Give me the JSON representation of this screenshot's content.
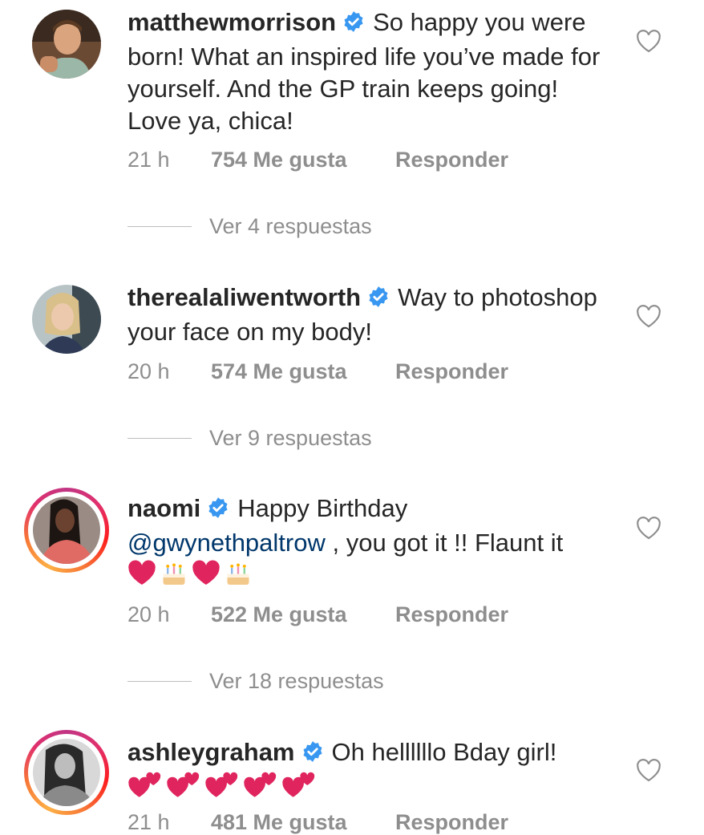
{
  "comments": [
    {
      "username": "matthewmorrison",
      "text": "So happy you were born!  What an inspired life you’ve made for yourself. And the GP train keeps going! Love ya, chica!",
      "time": "21 h",
      "likes": "754 Me gusta",
      "reply": "Responder",
      "replies": "Ver 4 respuestas"
    },
    {
      "username": "therealaliwentworth",
      "text": "Way to photoshop your face on my body!",
      "time": "20 h",
      "likes": "574 Me gusta",
      "reply": "Responder",
      "replies": "Ver 9 respuestas"
    },
    {
      "username": "naomi",
      "text_before": "Happy Birthday",
      "mention": "@gwynethpaltrow",
      "text_after": " , you got it !! Flaunt it",
      "emojis": [
        "red-heart",
        "birthday-cake",
        "red-heart",
        "birthday-cake"
      ],
      "time": "20 h",
      "likes": "522 Me gusta",
      "reply": "Responder",
      "replies": "Ver 18 respuestas"
    },
    {
      "username": "ashleygraham",
      "text": "Oh hellllllo Bday girl!",
      "emojis": [
        "two-hearts",
        "two-hearts",
        "two-hearts",
        "two-hearts",
        "two-hearts"
      ],
      "time": "21 h",
      "likes": "481 Me gusta",
      "reply": "Responder"
    }
  ],
  "colors": {
    "verified": "#3897f0",
    "text": "#262626",
    "secondary": "#8e8e8e",
    "mention": "#00376b",
    "heart_emoji": "#e0245e"
  }
}
